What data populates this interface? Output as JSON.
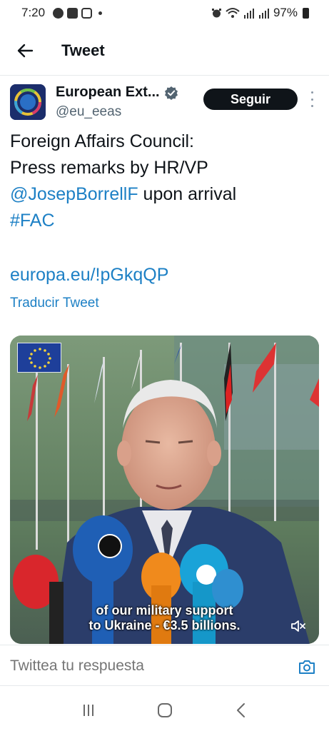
{
  "status_bar": {
    "time": "7:20",
    "battery": "97%",
    "left_icons": [
      "pinterest-icon",
      "gallery-icon",
      "instagram-icon",
      "dot-icon"
    ],
    "right_icons": [
      "alarm-icon",
      "wifi-icon",
      "signal-icon",
      "signal-icon",
      "battery-icon"
    ]
  },
  "header": {
    "title": "Tweet",
    "back_icon": "arrow-left-icon"
  },
  "author": {
    "name": "European Ext...",
    "handle": "@eu_eeas",
    "verified": true,
    "follow_label": "Seguir",
    "more_icon": "more-vertical-icon"
  },
  "tweet": {
    "text_line1": "Foreign Affairs Council:",
    "text_line2": "Press remarks by HR/VP",
    "mention": "@JosepBorrellF",
    "text_line3_rest": " upon arrival",
    "hashtag": "#FAC",
    "link": "europa.eu/!pGkqQP",
    "translate_label": "Traducir Tweet"
  },
  "media": {
    "subtitle_line1": "of our military support",
    "subtitle_line2": "to Ukraine - €3.5 billions.",
    "mute_icon": "speaker-muted-icon"
  },
  "reply": {
    "placeholder": "Twittea tu respuesta",
    "camera_icon": "camera-icon"
  },
  "nav": {
    "icons": [
      "recent-apps-icon",
      "home-icon",
      "back-icon"
    ]
  },
  "colors": {
    "link": "#1d80c5",
    "follow_bg": "#0f1419",
    "verified": "#536471",
    "secondary_text": "#536471"
  }
}
